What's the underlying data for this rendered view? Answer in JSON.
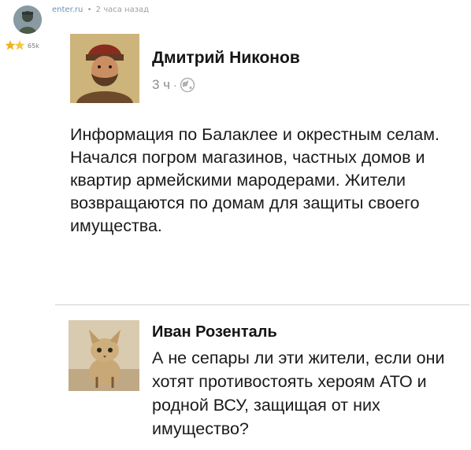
{
  "meta": {
    "source": "enter.ru",
    "separator": "•",
    "time_ago": "2 часа назад",
    "rating_count": "65k"
  },
  "post": {
    "author_name": "Дмитрий Никонов",
    "time": "3 ч",
    "time_separator": "·",
    "privacy_icon": "globe-icon",
    "paragraph_1": "Информация по Балаклее и окрестным селам.",
    "paragraph_2": "Начался погром магазинов, частных домов и квартир армейскими мародерами. Жители возвращаются по домам для защиты своего имущества."
  },
  "reply": {
    "author_name": "Иван Розенталь",
    "text": "А не сепары ли эти жители, если они хотят противостоять хероям АТО и родной ВСУ, защищая от них имущество?"
  },
  "colors": {
    "source_link": "#6f90b8",
    "meta_gray": "#a0a0a0",
    "text": "#1a1a1a",
    "divider": "#cfcfcf",
    "star_gold": "#f2b21b"
  }
}
